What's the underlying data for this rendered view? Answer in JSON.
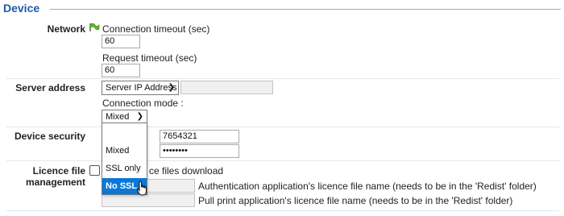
{
  "section": {
    "title": "Device"
  },
  "network": {
    "label": "Network",
    "icon": "green-flag-icon",
    "connection_timeout_label": "Connection timeout (sec)",
    "connection_timeout_value": "60",
    "request_timeout_label": "Request timeout (sec)",
    "request_timeout_value": "60"
  },
  "server_address": {
    "label": "Server address",
    "type_select_value": "Server IP Address",
    "address_value": "",
    "connection_mode_label": "Connection mode :",
    "connection_mode_value": "Mixed",
    "connection_mode_options": [
      "Mixed",
      "SSL only",
      "No SSL"
    ],
    "highlighted_option": "No SSL"
  },
  "device_security": {
    "label": "Device security",
    "field1_value": "7654321",
    "password_value": "••••••••"
  },
  "licence": {
    "label_line1": "Licence file",
    "label_line2": "management",
    "checkbox_text_partial": "ce files download",
    "checked": false,
    "auth_licence_desc": "Authentication application's licence file name (needs to be in the 'Redist' folder)",
    "pull_print_licence_desc": "Pull print application's licence file name (needs to be in the 'Redist' folder)"
  },
  "colors": {
    "title": "#1e5aa8",
    "option_highlight": "#0a78d7"
  }
}
